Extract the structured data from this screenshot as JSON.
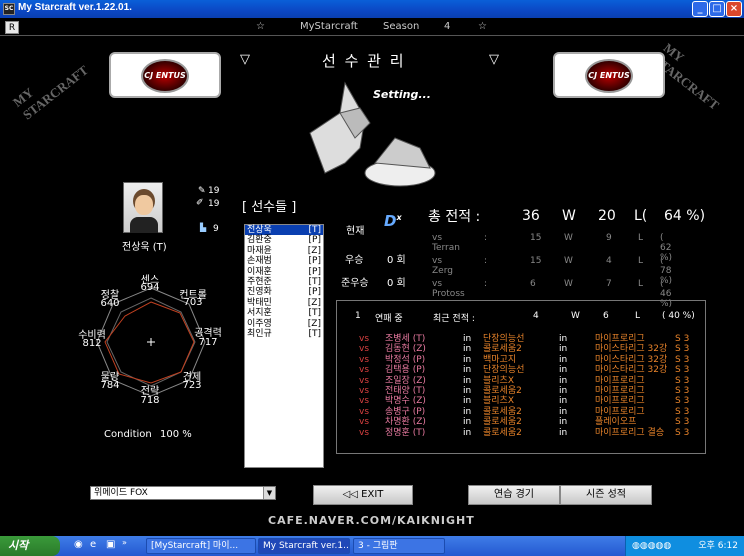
{
  "window": {
    "title": "My Starcraft ver.1.22.01.",
    "app_icon": "starcraft-icon",
    "min": "_",
    "max": "□",
    "close": "×"
  },
  "topbar": {
    "r_button": "R",
    "star_left": "☆",
    "game_name": "MyStarcraft",
    "season_label": "Season",
    "season_number": "4",
    "star_right": "☆"
  },
  "header": {
    "arrow_left": "▽",
    "title": "선 수 관 리",
    "arrow_right": "▽",
    "setting": "Setting...",
    "corner_left": "MY STARCRAFT",
    "corner_right": "MY STARCRAFT",
    "logo_text": "CJ ENTUS"
  },
  "player": {
    "name": "전상욱 (T)",
    "icon_a_value": "19",
    "icon_b_value": "19",
    "icon_c_value": "9",
    "stats": {
      "sense_label": "센스",
      "sense": "694",
      "control_label": "컨트롤",
      "control": "703",
      "attack_label": "공격력",
      "attack": "717",
      "defense_label": "견제",
      "defense": "723",
      "strategy_label": "전략",
      "strategy": "718",
      "material_label": "물량",
      "material": "784",
      "defend_label": "수비력",
      "defend": "812",
      "scout_label": "정찰",
      "scout": "640"
    },
    "condition_label": "Condition",
    "condition_value": "100 %"
  },
  "roster": {
    "heading": "[ 선수들 ]",
    "players": [
      {
        "name": "전상욱",
        "race": "[T]",
        "selected": true
      },
      {
        "name": "김환중",
        "race": "[P]"
      },
      {
        "name": "마재윤",
        "race": "[Z]"
      },
      {
        "name": "손재범",
        "race": "[P]"
      },
      {
        "name": "이재훈",
        "race": "[P]"
      },
      {
        "name": "주현준",
        "race": "[T]"
      },
      {
        "name": "진영화",
        "race": "[P]"
      },
      {
        "name": "박태민",
        "race": "[Z]"
      },
      {
        "name": "서지훈",
        "race": "[T]"
      },
      {
        "name": "이주영",
        "race": "[Z]"
      },
      {
        "name": "최인규",
        "race": "[T]"
      }
    ]
  },
  "totals": {
    "current_label": "현재",
    "total_label": "총 전적 :",
    "wins": "36",
    "w": "W",
    "losses": "20",
    "l": "L(",
    "rate": "64 %)",
    "vs_rows": [
      {
        "label": "vs Terran",
        "colon": ":",
        "w": "15",
        "wl": "W",
        "l": "9",
        "ll": "L",
        "rate": "( 62 %)"
      },
      {
        "label": "vs Zerg",
        "colon": ":",
        "w": "15",
        "wl": "W",
        "l": "4",
        "ll": "L",
        "rate": "( 78 %)"
      },
      {
        "label": "vs Protoss",
        "colon": ":",
        "w": "6",
        "wl": "W",
        "l": "7",
        "ll": "L",
        "rate": "( 46 %)"
      }
    ],
    "win_label": "우승",
    "win_count": "0 회",
    "runnerup_label": "준우승",
    "runnerup_count": "0 회"
  },
  "recent": {
    "streak_num": "1",
    "streak_label": "연패 중",
    "recent_label": "최근 전적 :",
    "wins": "4",
    "w": "W",
    "losses": "6",
    "l": "L",
    "rate": "( 40 %)",
    "matches": [
      {
        "vs": "vs",
        "opp": "조병세 (T)",
        "in": "in",
        "map": "단장의능선",
        "in2": "in",
        "league": "마이프로리그",
        "season": "S 3"
      },
      {
        "vs": "vs",
        "opp": "김동현 (Z)",
        "in": "in",
        "map": "콜로세움2",
        "in2": "in",
        "league": "마이스타리그 32강",
        "season": "S 3"
      },
      {
        "vs": "vs",
        "opp": "박정석 (P)",
        "in": "in",
        "map": "백마고지",
        "in2": "in",
        "league": "마이스타리그 32강",
        "season": "S 3"
      },
      {
        "vs": "vs",
        "opp": "김택용 (P)",
        "in": "in",
        "map": "단장의능선",
        "in2": "in",
        "league": "마이스타리그 32강",
        "season": "S 3"
      },
      {
        "vs": "vs",
        "opp": "조일장 (Z)",
        "in": "in",
        "map": "블리츠X",
        "in2": "in",
        "league": "마이프로리그",
        "season": "S 3"
      },
      {
        "vs": "vs",
        "opp": "전태양 (T)",
        "in": "in",
        "map": "콜로세움2",
        "in2": "in",
        "league": "마이프로리그",
        "season": "S 3"
      },
      {
        "vs": "vs",
        "opp": "박명수 (Z)",
        "in": "in",
        "map": "블리츠X",
        "in2": "in",
        "league": "마이프로리그",
        "season": "S 3"
      },
      {
        "vs": "vs",
        "opp": "송병구 (P)",
        "in": "in",
        "map": "콜로세움2",
        "in2": "in",
        "league": "마이프로리그",
        "season": "S 3"
      },
      {
        "vs": "vs",
        "opp": "차명환 (Z)",
        "in": "in",
        "map": "콜로세움2",
        "in2": "in",
        "league": "플레이오프",
        "season": "S 3"
      },
      {
        "vs": "vs",
        "opp": "정명훈 (T)",
        "in": "in",
        "map": "콜로세움2",
        "in2": "in",
        "league": "마이프로리그 결승",
        "season": "S 3"
      }
    ]
  },
  "bottom": {
    "team_select": "위메이드 FOX",
    "exit": "◁◁ EXIT",
    "practice": "연습 경기",
    "season_record": "시즌 성적",
    "footer": "CAFE.NAVER.COM/KAIKNIGHT"
  },
  "taskbar": {
    "start": "시작",
    "tasks": [
      "[MyStarcraft] 마이...",
      "My Starcraft ver.1....",
      "3 - 그림판"
    ],
    "clock": "오후 6:12"
  },
  "colors": {
    "titlebar": "#0b47c4",
    "accent_orange": "#e8832a",
    "vs_red": "#d94040",
    "grey_text": "#aaaaaa"
  }
}
